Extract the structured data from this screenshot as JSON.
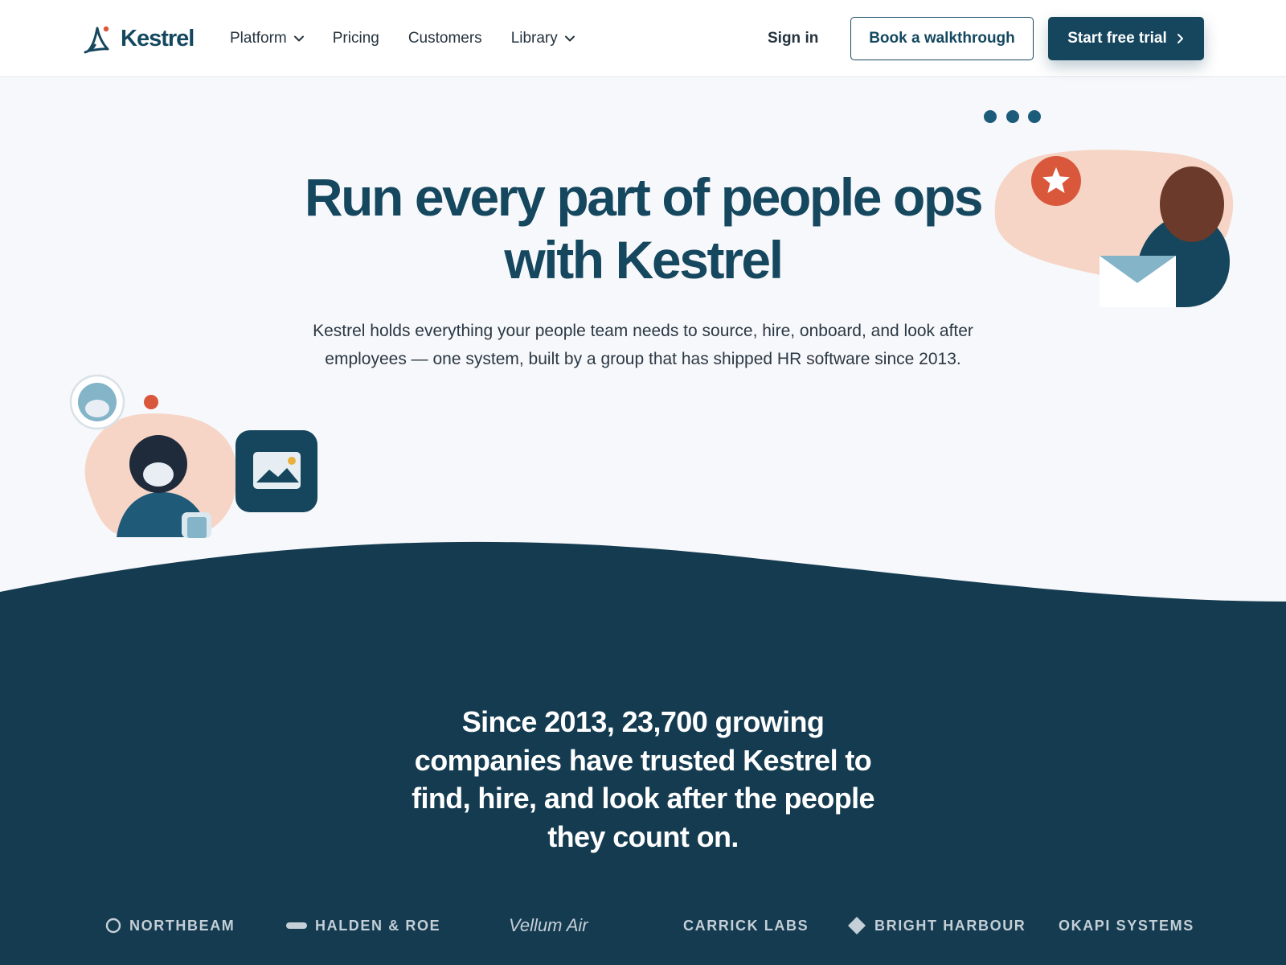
{
  "brand": {
    "name": "Kestrel",
    "colors": {
      "primary": "#15465d",
      "dark_band": "#143b50",
      "accent_orange": "#d9573a",
      "peach": "#f6d5c7",
      "light_blue": "#83b4c8"
    }
  },
  "header": {
    "nav": [
      {
        "label": "Platform",
        "has_dropdown": true
      },
      {
        "label": "Pricing",
        "has_dropdown": false
      },
      {
        "label": "Customers",
        "has_dropdown": false
      },
      {
        "label": "Library",
        "has_dropdown": true
      }
    ],
    "sign_in": "Sign in",
    "secondary_cta": "Book a walkthrough",
    "primary_cta": "Start free trial"
  },
  "hero": {
    "title_line1": "Run every part of people ops",
    "title_line2": "with Kestrel",
    "subtitle": "Kestrel holds everything your people team needs to source, hire, onboard, and look after employees — one system, built by a group that has shipped HR software since 2013."
  },
  "trust": {
    "headline": "Since 2013, 23,700 growing companies have trusted Kestrel to find, hire, and look after the people they count on.",
    "clients": [
      {
        "name": "NORTHBEAM",
        "icon": "ring-icon"
      },
      {
        "name": "HALDEN & ROE",
        "icon": "bar-icon"
      },
      {
        "name": "Vellum Air",
        "icon": "none"
      },
      {
        "name": "CARRICK LABS",
        "icon": "none"
      },
      {
        "name": "BRIGHT HARBOUR",
        "icon": "diamond-icon"
      },
      {
        "name": "OKAPI SYSTEMS",
        "icon": "none"
      }
    ]
  },
  "illustrations": {
    "right": [
      "three-dots-icon",
      "star-badge-icon",
      "person-avatar",
      "envelope-icon"
    ],
    "left": [
      "profile-ring-icon",
      "notification-dot",
      "person-avatar",
      "image-card-icon"
    ]
  }
}
